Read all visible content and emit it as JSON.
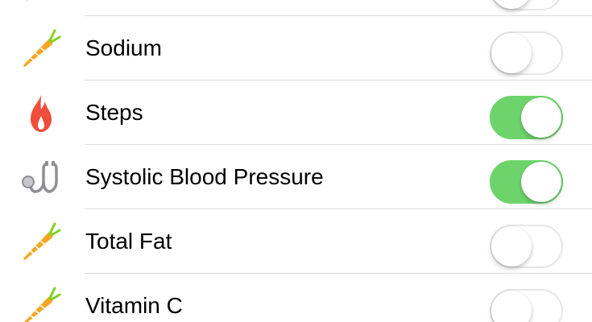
{
  "colors": {
    "toggle_on": "#6dd46b",
    "toggle_off_border": "#e6e6e9",
    "divider": "#dcdce0",
    "carrot": "#f6a623",
    "leaf": "#7ed321",
    "flame": "#f04e3a",
    "stethoscope": "#8e8e93"
  },
  "rows": [
    {
      "label": "",
      "icon": "carrot-icon",
      "enabled": false
    },
    {
      "label": "Sodium",
      "icon": "carrot-icon",
      "enabled": false
    },
    {
      "label": "Steps",
      "icon": "flame-icon",
      "enabled": true
    },
    {
      "label": "Systolic Blood Pressure",
      "icon": "stethoscope-icon",
      "enabled": true
    },
    {
      "label": "Total Fat",
      "icon": "carrot-icon",
      "enabled": false
    },
    {
      "label": "Vitamin C",
      "icon": "carrot-icon",
      "enabled": false
    }
  ]
}
